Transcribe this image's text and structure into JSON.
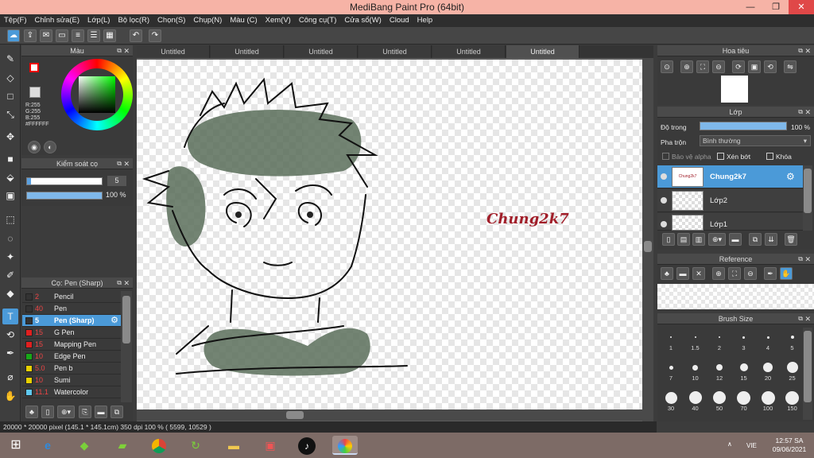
{
  "window": {
    "title": "MediBang Paint Pro (64bit)",
    "min": "—",
    "max": "❐",
    "close": "✕"
  },
  "menu": [
    "Tệp(F)",
    "Chỉnh sửa(E)",
    "Lớp(L)",
    "Bộ lọc(R)",
    "Chọn(S)",
    "Chụp(N)",
    "Màu (C)",
    "Xem(V)",
    "Công cụ(T)",
    "Cửa sổ(W)",
    "Cloud",
    "Help"
  ],
  "tabs": [
    "Untitled",
    "Untitled",
    "Untitled",
    "Untitled",
    "Untitled",
    "Untitled"
  ],
  "active_tab_index": 5,
  "color_panel": {
    "title": "Màu",
    "r": "R:255",
    "g": "G:255",
    "b": "B:255",
    "hex": "#FFFFFF",
    "fg": "#ff0000",
    "bg": "#ffffff"
  },
  "brush_control": {
    "title": "Kiểm soát cọ",
    "size": "5",
    "opacity": "100 %",
    "opacity_fraction": 1.0
  },
  "brush_list": {
    "title": "Cọ: Pen (Sharp)",
    "items": [
      {
        "color": "#333333",
        "size": "2",
        "name": "Pencil"
      },
      {
        "color": "#333333",
        "size": "40",
        "name": "Pen"
      },
      {
        "color": "#333333",
        "size": "5",
        "name": "Pen (Sharp)"
      },
      {
        "color": "#e02020",
        "size": "15",
        "name": "G Pen"
      },
      {
        "color": "#e02020",
        "size": "15",
        "name": "Mapping Pen"
      },
      {
        "color": "#18a818",
        "size": "10",
        "name": "Edge Pen"
      },
      {
        "color": "#e8d000",
        "size": "5.0",
        "name": "Pen b"
      },
      {
        "color": "#e8d000",
        "size": "10",
        "name": "Sumi"
      },
      {
        "color": "#5fc8f0",
        "size": "11.1",
        "name": "Watercolor"
      }
    ],
    "selected_index": 2
  },
  "canvas": {
    "watermark": "Chung2k7"
  },
  "status": "20000 * 20000 pixel  (145.1 * 145.1cm)  350 dpi  100 %  ( 5599, 10529 )",
  "navigator": {
    "title": "Hoa tiêu"
  },
  "layer_panel": {
    "title": "Lớp",
    "opacity_label": "Độ trong",
    "opacity_value": "100 %",
    "opacity_fraction": 1.0,
    "blend_label": "Pha trộn",
    "blend_value": "Bình thường",
    "protect_alpha": "Bảo vệ alpha",
    "clipping": "Xén bớt",
    "lock": "Khóa",
    "layers": [
      {
        "name": "Chung2k7",
        "selected": true,
        "thumb_text": "Chung2k7"
      },
      {
        "name": "Lớp2",
        "selected": false
      },
      {
        "name": "Lớp1",
        "selected": false
      }
    ]
  },
  "reference": {
    "title": "Reference"
  },
  "brush_size": {
    "title": "Brush Size",
    "sizes": [
      "1",
      "1.5",
      "2",
      "3",
      "4",
      "5",
      "7",
      "10",
      "12",
      "15",
      "20",
      "25",
      "30",
      "40",
      "50",
      "70",
      "100",
      "150"
    ]
  },
  "taskbar": {
    "time": "12:57 SA",
    "date": "09/06/2021",
    "lang": "VIE"
  }
}
